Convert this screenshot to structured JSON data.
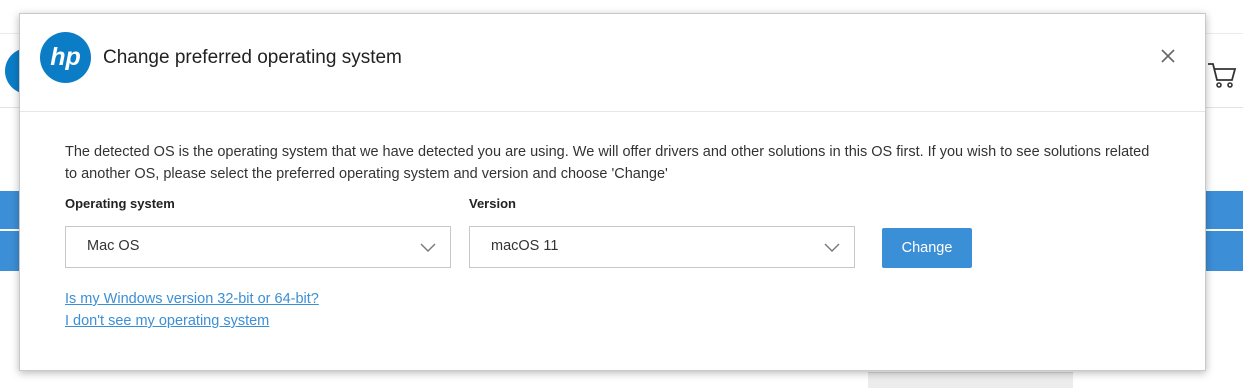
{
  "dialog": {
    "title": "Change preferred operating system",
    "description": "The detected OS is the operating system that we have detected you are using. We will offer drivers and other solutions in this OS first. If you wish to see solutions related to another OS, please select the preferred operating system and version and choose 'Change'",
    "os_label": "Operating system",
    "os_selected": "Mac OS",
    "version_label": "Version",
    "version_selected": "macOS 11",
    "change_label": "Change",
    "link_bitness": "Is my Windows version 32-bit or 64-bit?",
    "link_missing_os": "I don't see my operating system"
  },
  "icons": {
    "logo": "hp-logo",
    "close": "close-icon",
    "chevron": "chevron-down-icon",
    "cart": "cart-icon"
  },
  "colors": {
    "accent": "#3a8fd6",
    "hp_blue": "#0b7dc7",
    "background_band": "#3c8fd7"
  }
}
